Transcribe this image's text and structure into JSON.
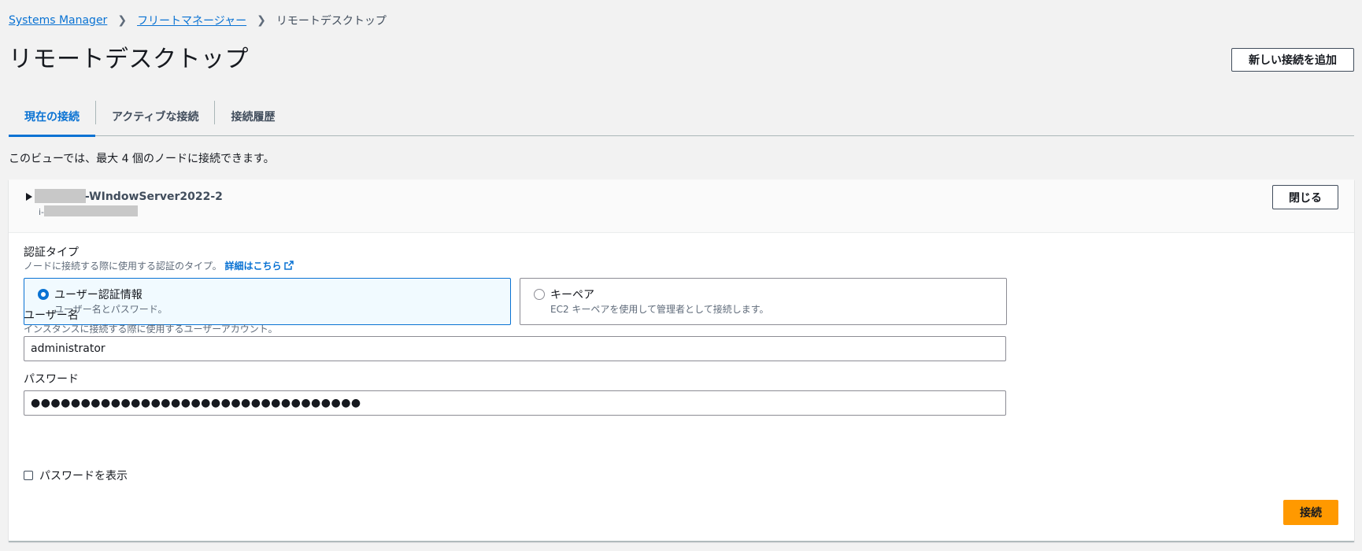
{
  "breadcrumb": {
    "items": [
      "Systems Manager",
      "フリートマネージャー"
    ],
    "current": "リモートデスクトップ"
  },
  "page": {
    "title": "リモートデスクトップ",
    "add_connection_label": "新しい接続を追加"
  },
  "tabs": [
    {
      "label": "現在の接続",
      "active": true
    },
    {
      "label": "アクティブな接続",
      "active": false
    },
    {
      "label": "接続履歴",
      "active": false
    }
  ],
  "info_text": "このビューでは、最大 4 個のノードに接続できます。",
  "connection": {
    "node_name_suffix": "-WIndowServer2022-2",
    "node_id_prefix": "i-",
    "close_label": "閉じる",
    "auth_type": {
      "label": "認証タイプ",
      "description": "ノードに接続する際に使用する認証のタイプ。",
      "link_label": "詳細はこちら",
      "options": [
        {
          "title": "ユーザー認証情報",
          "description": "ユーザー名とパスワード。",
          "selected": true
        },
        {
          "title": "キーペア",
          "description": "EC2 キーペアを使用して管理者として接続します。",
          "selected": false
        }
      ]
    },
    "username": {
      "label": "ユーザー名",
      "description": "インスタンスに接続する際に使用するユーザーアカウント。",
      "value": "administrator"
    },
    "password": {
      "label": "パスワード",
      "masked_value": "●●●●●●●●●●●●●●●●●●●●●●●●●●●●●●●●●"
    },
    "show_password_label": "パスワードを表示",
    "show_password_checked": false,
    "connect_label": "接続"
  },
  "colors": {
    "accent": "#0972d3",
    "primary_button": "#ff9900"
  }
}
